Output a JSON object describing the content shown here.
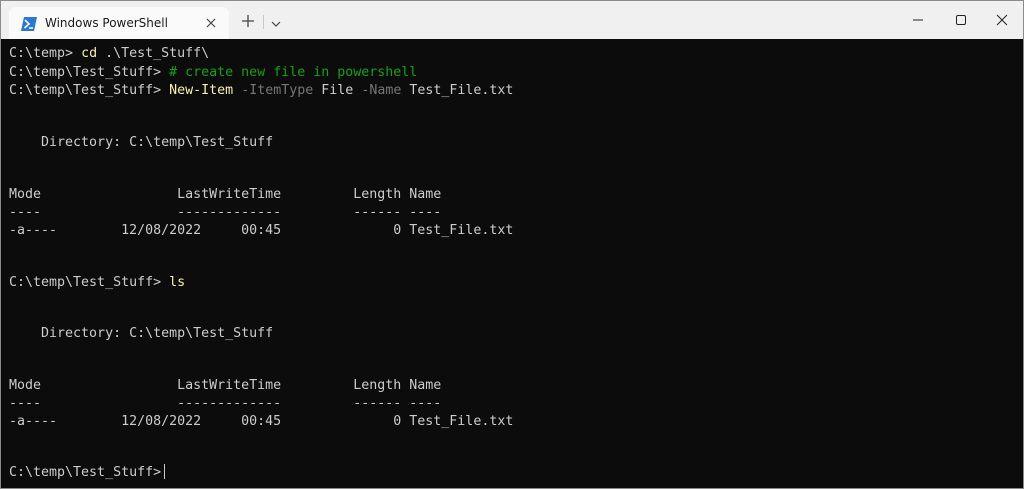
{
  "window": {
    "tab_title": "Windows PowerShell",
    "icons": {
      "tab_icon": "powershell-icon",
      "tab_close": "close-icon",
      "new_tab": "plus-icon",
      "dropdown": "chevron-down-icon",
      "minimize": "minimize-icon",
      "maximize": "maximize-icon",
      "close": "close-icon"
    }
  },
  "colors": {
    "background": "#0c0c0c",
    "text": "#cccccc",
    "command": "#f9f1a5",
    "comment": "#13a10e",
    "parameter": "#767676",
    "powershell_blue": "#2a78d4"
  },
  "terminal": {
    "prompt1": "C:\\temp>",
    "cmd1": "cd",
    "arg1": ".\\Test_Stuff\\",
    "prompt2": "C:\\temp\\Test_Stuff>",
    "comment2": "# create new file in powershell",
    "prompt3": "C:\\temp\\Test_Stuff>",
    "cmd3": "New-Item",
    "param3a": "-ItemType",
    "val3a": "File",
    "param3b": "-Name",
    "val3b": "Test_File.txt",
    "dir1": "    Directory: C:\\temp\\Test_Stuff",
    "header1": "Mode                 LastWriteTime         Length Name",
    "dashes1": "----                 -------------         ------ ----",
    "row1": "-a----        12/08/2022     00:45              0 Test_File.txt",
    "prompt4": "C:\\temp\\Test_Stuff>",
    "cmd4": "ls",
    "dir2": "    Directory: C:\\temp\\Test_Stuff",
    "header2": "Mode                 LastWriteTime         Length Name",
    "dashes2": "----                 -------------         ------ ----",
    "row2": "-a----        12/08/2022     00:45              0 Test_File.txt",
    "prompt5": "C:\\temp\\Test_Stuff>"
  }
}
